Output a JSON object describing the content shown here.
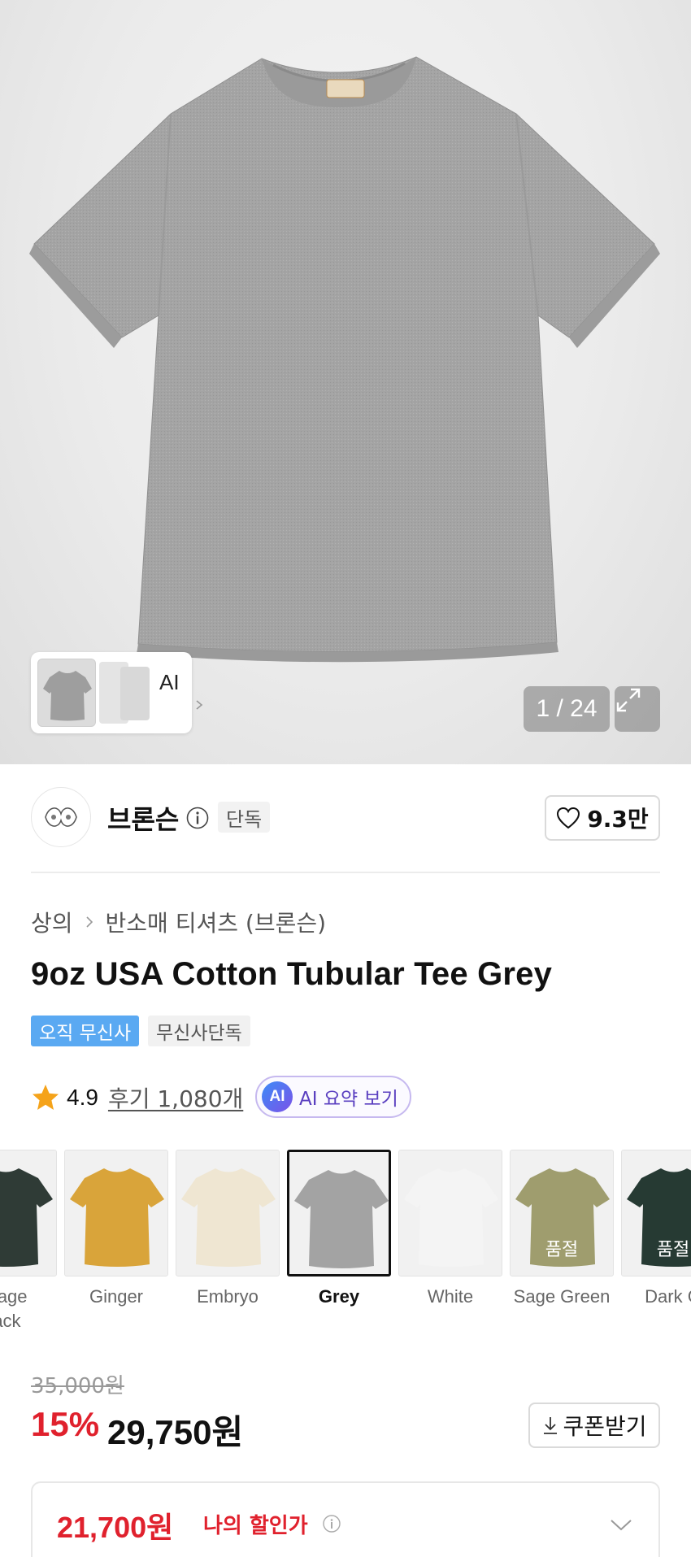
{
  "gallery": {
    "counter": "1 / 24",
    "ai_label": "AI",
    "icons": [
      "chevron-right-icon",
      "expand-icon"
    ]
  },
  "brand": {
    "name": "브론슨",
    "badge": "단독",
    "likes": "9.3만",
    "icons": [
      "info-icon",
      "heart-icon"
    ]
  },
  "breadcrumb": {
    "category": "상의",
    "subcategory": "반소매 티셔츠 (브론슨)"
  },
  "product": {
    "title": "9oz USA Cotton Tubular Tee Grey",
    "tags": [
      "오직 무신사",
      "무신사단독"
    ]
  },
  "rating": {
    "score": "4.9",
    "reviews": "후기 1,080개",
    "ai_summary": "AI 요약 보기",
    "ai_badge": "AI"
  },
  "colors": {
    "options": [
      {
        "label": "Vintage Black",
        "display": "ntage\nlack",
        "color": "#2f3b36",
        "soldout": ""
      },
      {
        "label": "Ginger",
        "display": "Ginger",
        "color": "#d9a43a",
        "soldout": ""
      },
      {
        "label": "Embryo",
        "display": "Embryo",
        "color": "#efe6d2",
        "soldout": ""
      },
      {
        "label": "Grey",
        "display": "Grey",
        "color": "#a3a3a3",
        "soldout": "",
        "selected": true
      },
      {
        "label": "White",
        "display": "White",
        "color": "#f4f4f4",
        "soldout": ""
      },
      {
        "label": "Sage Green",
        "display": "Sage Green",
        "color": "#9f9d6e",
        "soldout": "품절"
      },
      {
        "label": "Dark Green",
        "display": "Dark G",
        "color": "#263a33",
        "soldout": "품절"
      }
    ]
  },
  "price": {
    "original": "35,000원",
    "discount": "15%",
    "sale": "29,750원",
    "coupon": "쿠폰받기",
    "my_price": "21,700원",
    "my_price_label": "나의 할인가"
  },
  "theme": {
    "accent_red": "#e0212d",
    "tag_blue": "#5aa9f2",
    "ai_purple": "#5a3fc0"
  }
}
